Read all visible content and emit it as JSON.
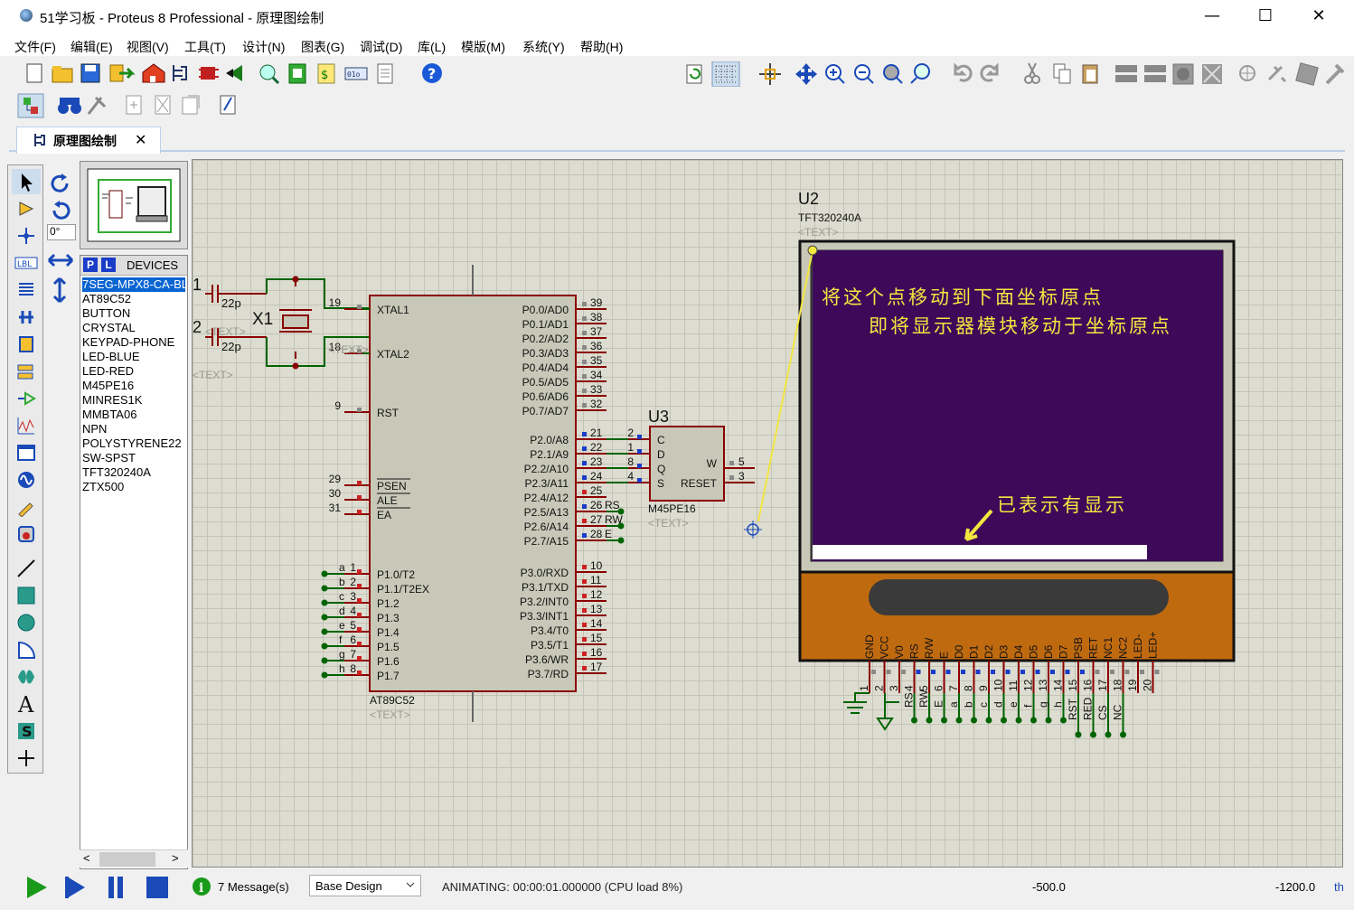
{
  "window": {
    "title": "51学习板 - Proteus 8 Professional - 原理图绘制",
    "minimize": "—",
    "maximize": "☐",
    "close": "✕"
  },
  "menu": [
    "文件(F)",
    "编辑(E)",
    "视图(V)",
    "工具(T)",
    "设计(N)",
    "图表(G)",
    "调试(D)",
    "库(L)",
    "模版(M)",
    "系统(Y)",
    "帮助(H)"
  ],
  "tab": {
    "label": "原理图绘制",
    "close": "✕"
  },
  "rotation": "0°",
  "devices": {
    "header": "DEVICES",
    "p": "P",
    "l": "L",
    "items": [
      "7SEG-MPX8-CA-BL",
      "AT89C52",
      "BUTTON",
      "CRYSTAL",
      "KEYPAD-PHONE",
      "LED-BLUE",
      "LED-RED",
      "M45PE16",
      "MINRES1K",
      "MMBTA06",
      "NPN",
      "POLYSTYRENE22",
      "SW-SPST",
      "TFT320240A",
      "ZTX500"
    ],
    "selected": 0
  },
  "schematic": {
    "u1": {
      "part": "AT89C52",
      "text": "<TEXT>",
      "left_pins": [
        {
          "num": "19",
          "name": "XTAL1"
        },
        {
          "num": "18",
          "name": "XTAL2"
        },
        {
          "num": "9",
          "name": "RST"
        },
        {
          "num": "29",
          "name": "PSEN"
        },
        {
          "num": "30",
          "name": "ALE"
        },
        {
          "num": "31",
          "name": "EA"
        },
        {
          "num": "1",
          "name": "P1.0/T2",
          "net": "a"
        },
        {
          "num": "2",
          "name": "P1.1/T2EX",
          "net": "b"
        },
        {
          "num": "3",
          "name": "P1.2",
          "net": "c"
        },
        {
          "num": "4",
          "name": "P1.3",
          "net": "d"
        },
        {
          "num": "5",
          "name": "P1.4",
          "net": "e"
        },
        {
          "num": "6",
          "name": "P1.5",
          "net": "f"
        },
        {
          "num": "7",
          "name": "P1.6",
          "net": "g"
        },
        {
          "num": "8",
          "name": "P1.7",
          "net": "h"
        }
      ],
      "right_pins": [
        {
          "num": "39",
          "name": "P0.0/AD0"
        },
        {
          "num": "38",
          "name": "P0.1/AD1"
        },
        {
          "num": "37",
          "name": "P0.2/AD2"
        },
        {
          "num": "36",
          "name": "P0.3/AD3"
        },
        {
          "num": "35",
          "name": "P0.4/AD4"
        },
        {
          "num": "34",
          "name": "P0.5/AD5"
        },
        {
          "num": "33",
          "name": "P0.6/AD6"
        },
        {
          "num": "32",
          "name": "P0.7/AD7"
        },
        {
          "num": "21",
          "name": "P2.0/A8"
        },
        {
          "num": "22",
          "name": "P2.1/A9"
        },
        {
          "num": "23",
          "name": "P2.2/A10"
        },
        {
          "num": "24",
          "name": "P2.3/A11"
        },
        {
          "num": "25",
          "name": "P2.4/A12"
        },
        {
          "num": "26",
          "name": "P2.5/A13",
          "net": "RS"
        },
        {
          "num": "27",
          "name": "P2.6/A14",
          "net": "RW"
        },
        {
          "num": "28",
          "name": "P2.7/A15",
          "net": "E"
        },
        {
          "num": "10",
          "name": "P3.0/RXD"
        },
        {
          "num": "11",
          "name": "P3.1/TXD"
        },
        {
          "num": "12",
          "name": "P3.2/INT0"
        },
        {
          "num": "13",
          "name": "P3.3/INT1"
        },
        {
          "num": "14",
          "name": "P3.4/T0"
        },
        {
          "num": "15",
          "name": "P3.5/T1"
        },
        {
          "num": "16",
          "name": "P3.6/WR"
        },
        {
          "num": "17",
          "name": "P3.7/RD"
        }
      ]
    },
    "x1": {
      "ref": "X1"
    },
    "caps": [
      {
        "pin": "1",
        "value": "22p",
        "text": "<TEXT>"
      },
      {
        "pin": "2",
        "value": "22p",
        "text": "<TEXT>"
      }
    ],
    "text_labels": [
      "<TEXT>",
      "<TEXT>"
    ],
    "u3": {
      "ref": "U3",
      "part": "M45PE16",
      "text": "<TEXT>",
      "pins_left": [
        {
          "num": "2",
          "name": "C"
        },
        {
          "num": "1",
          "name": "D"
        },
        {
          "num": "8",
          "name": "Q"
        },
        {
          "num": "4",
          "name": "S"
        }
      ],
      "pins_right": [
        {
          "num": "5",
          "name": "W"
        },
        {
          "num": "3",
          "name": "RESET"
        }
      ]
    },
    "u2": {
      "ref": "U2",
      "part": "TFT320240A",
      "text": "<TEXT>",
      "pin_names": [
        "GND",
        "VCC",
        "V0",
        "RS",
        "R/W",
        "E",
        "D0",
        "D1",
        "D2",
        "D3",
        "D4",
        "D5",
        "D6",
        "D7",
        "PSB",
        "RET",
        "NC1",
        "NC2",
        "LED-",
        "LED+"
      ],
      "pin_nums": [
        "1",
        "2",
        "3",
        "4",
        "5",
        "6",
        "7",
        "8",
        "9",
        "10",
        "11",
        "12",
        "13",
        "14",
        "15",
        "16",
        "17",
        "18",
        "19",
        "20"
      ],
      "net_labels": [
        "RS",
        "RW",
        "E",
        "a",
        "b",
        "c",
        "d",
        "e",
        "f",
        "g",
        "h",
        "RST",
        "RED",
        "CS",
        "NC"
      ]
    },
    "annotation1": "将这个点移动到下面坐标原点",
    "annotation2": "即将显示器模块移动于坐标原点",
    "annotation3": "已表示有显示"
  },
  "status": {
    "messages": "7 Message(s)",
    "design": "Base Design",
    "animating": "ANIMATING: 00:00:01.000000 (CPU load 8%)",
    "x": "-500.0",
    "y": "-1200.0",
    "unit": "th"
  },
  "colors": {
    "wire": "#006400",
    "component": "#8b0000",
    "compfill": "#c8c8b8",
    "lcd": "#3d0a5a",
    "lcdframe": "#c06a10",
    "accent": "#0a64d2"
  }
}
